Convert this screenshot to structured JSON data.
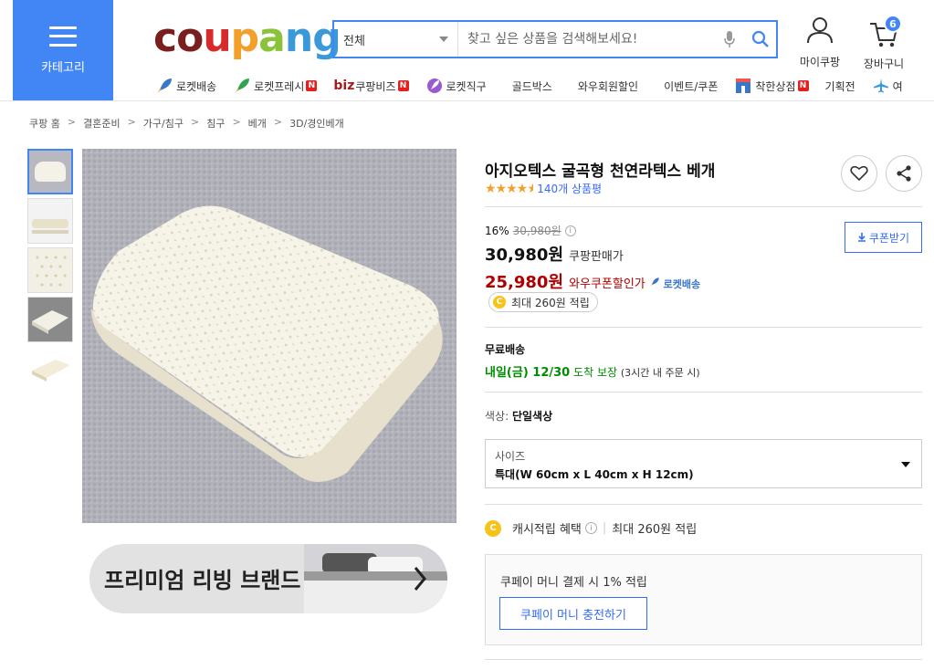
{
  "header": {
    "category_label": "카테고리",
    "logo_text": "coupang",
    "search": {
      "scope": "전체",
      "placeholder": "찾고 싶은 상품을 검색해보세요!"
    },
    "mypage_label": "마이쿠팡",
    "cart_label": "장바구니",
    "cart_count": "6"
  },
  "nav": {
    "items": [
      {
        "label": "로켓배송",
        "icon": "rocket-icon"
      },
      {
        "label": "로켓프레시",
        "icon": "rocket-fresh-icon",
        "badge": "N"
      },
      {
        "prefix": "biz",
        "label": "쿠팡비즈",
        "badge": "N"
      },
      {
        "label": "로켓직구",
        "icon": "global-rocket-icon"
      },
      {
        "label": "골드박스"
      },
      {
        "label": "와우회원할인"
      },
      {
        "label": "이벤트/쿠폰"
      },
      {
        "label": "착한상점",
        "icon": "shop-icon",
        "badge": "N"
      },
      {
        "label": "기획전"
      },
      {
        "label": "여",
        "icon": "plane-icon"
      }
    ]
  },
  "breadcrumb": [
    "쿠팡 홈",
    "결혼준비",
    "가구/침구",
    "침구",
    "베개",
    "3D/경인베개"
  ],
  "breadcrumb_sep": ">",
  "product": {
    "title": "아지오텍스 굴곡형 천연라텍스 베개",
    "rating": 4.5,
    "review_count": "140개 상품평",
    "discount_rate": "16%",
    "original_price": "30,980원",
    "sale_price": "30,980원",
    "sale_label": "쿠팡판매가",
    "wow_price": "25,980원",
    "wow_label": "와우쿠폰할인가",
    "rocket_tag": "로켓배송",
    "coupon_button": "쿠폰받기",
    "reward": "최대 260원 적립",
    "shipping_title": "무료배송",
    "delivery_date": "내일(금) 12/30",
    "delivery_guarantee": "도착 보장",
    "delivery_note": "(3시간 내 주문 시)",
    "color_label": "색상:",
    "color_value": "단일색상",
    "size_label": "사이즈",
    "size_value": "특대(W 60cm x L 40cm x H 12cm)",
    "cash_title": "캐시적립 혜택",
    "cash_value": "최대 260원 적립",
    "cpay_text": "쿠페이 머니 결제 시 1% 적립",
    "cpay_button": "쿠페이 머니 충전하기",
    "banner_text": "프리미엄 리빙 브랜드"
  },
  "colors": {
    "brand_blue": "#4285f4",
    "link_blue": "#346aff",
    "wow_red": "#ae0000",
    "delivery_green": "#008c00",
    "star": "#f2a02a"
  }
}
